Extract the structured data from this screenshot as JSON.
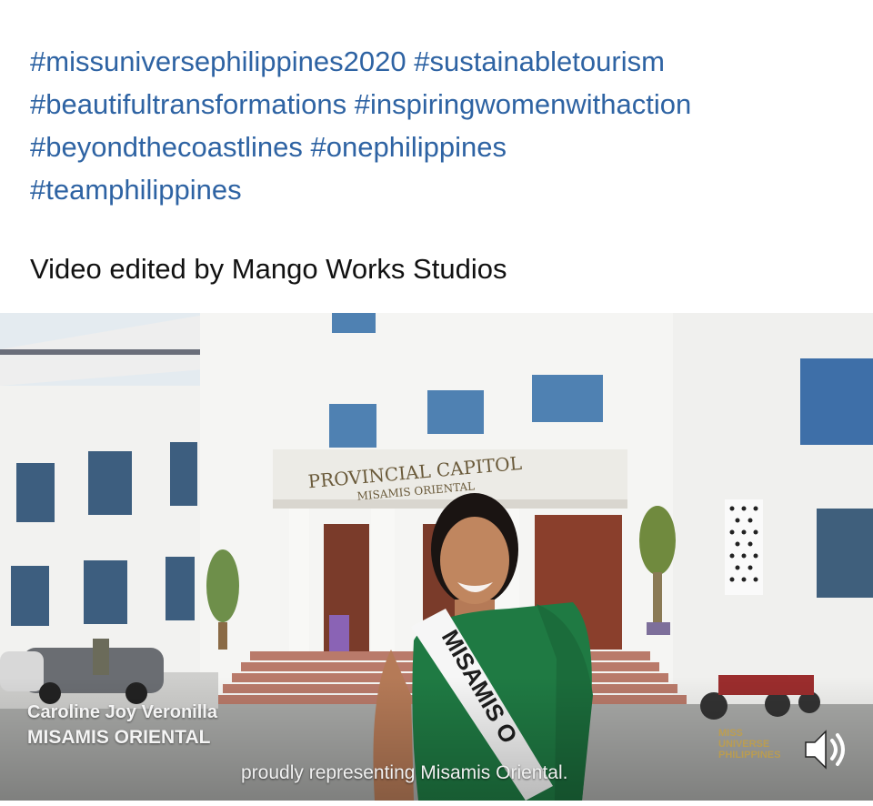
{
  "post": {
    "hashtags": [
      "#missuniversephilippines2020",
      "#sustainabletourism",
      "#beautifultransformations",
      "#inspiringwomenwithaction",
      "#beyondthecoastlines",
      "#onephilippines",
      "#teamphilippines"
    ],
    "credit": "Video edited by Mango Works Studios"
  },
  "video": {
    "building_sign": "PROVINCIAL CAPITOL",
    "building_subsign": "MISAMIS ORIENTAL",
    "sash_text": "MISAMIS O",
    "contestant_name": "Caroline Joy Veronilla",
    "contestant_place": "MISAMIS ORIENTAL",
    "caption": "proudly representing Misamis Oriental.",
    "watermark": "MISS UNIVERSE PHILIPPINES",
    "sound_icon": "speaker-volume-icon"
  },
  "colors": {
    "hashtag": "#2e63a3",
    "text": "#111111",
    "gown": "#1f7a43"
  }
}
